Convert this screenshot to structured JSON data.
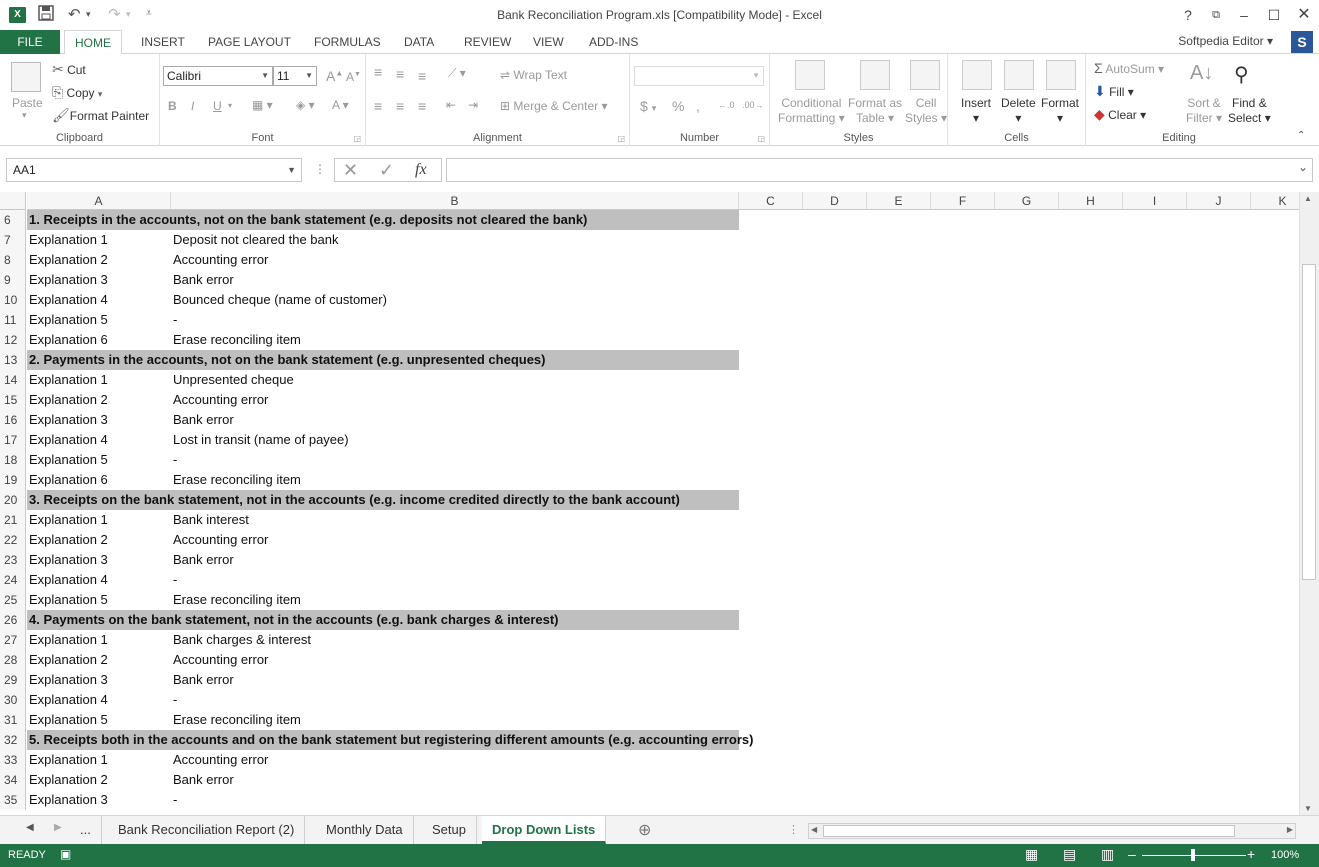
{
  "window": {
    "title": "Bank Reconciliation Program.xls  [Compatibility Mode] - Excel",
    "help": "?",
    "user": "Softpedia Editor",
    "user_initial": "S"
  },
  "tabs": [
    {
      "label": "FILE"
    },
    {
      "label": "HOME"
    },
    {
      "label": "INSERT"
    },
    {
      "label": "PAGE LAYOUT"
    },
    {
      "label": "FORMULAS"
    },
    {
      "label": "DATA"
    },
    {
      "label": "REVIEW"
    },
    {
      "label": "VIEW"
    },
    {
      "label": "ADD-INS"
    }
  ],
  "ribbon": {
    "clipboard": {
      "label": "Clipboard",
      "paste": "Paste",
      "cut": "Cut",
      "copy": "Copy",
      "format_painter": "Format Painter"
    },
    "font": {
      "label": "Font",
      "name": "Calibri",
      "size": "11",
      "bold": "B",
      "italic": "I",
      "underline": "U"
    },
    "alignment": {
      "label": "Alignment",
      "wrap": "Wrap Text",
      "merge": "Merge & Center"
    },
    "number": {
      "label": "Number",
      "currency": "$",
      "percent": "%",
      "comma": ","
    },
    "styles": {
      "label": "Styles",
      "cond1": "Conditional",
      "cond2": "Formatting",
      "table1": "Format as",
      "table2": "Table",
      "cell1": "Cell",
      "cell2": "Styles"
    },
    "cells": {
      "label": "Cells",
      "insert": "Insert",
      "delete": "Delete",
      "format": "Format"
    },
    "editing": {
      "label": "Editing",
      "autosum": "AutoSum",
      "fill": "Fill",
      "clear": "Clear",
      "sort1": "Sort &",
      "sort2": "Filter",
      "find1": "Find &",
      "find2": "Select"
    }
  },
  "formula_bar": {
    "name_box": "AA1",
    "fx": "fx",
    "value": ""
  },
  "columns": [
    "A",
    "B",
    "C",
    "D",
    "E",
    "F",
    "G",
    "H",
    "I",
    "J",
    "K"
  ],
  "rows": [
    {
      "n": "6",
      "header": true,
      "a": "1. Receipts in the accounts, not on the bank statement (e.g. deposits not cleared the bank)"
    },
    {
      "n": "7",
      "a": "Explanation 1",
      "b": "Deposit not cleared the bank"
    },
    {
      "n": "8",
      "a": "Explanation 2",
      "b": "Accounting error"
    },
    {
      "n": "9",
      "a": "Explanation 3",
      "b": "Bank error"
    },
    {
      "n": "10",
      "a": "Explanation 4",
      "b": "Bounced cheque (name of customer)"
    },
    {
      "n": "11",
      "a": "Explanation 5",
      "b": "-"
    },
    {
      "n": "12",
      "a": "Explanation 6",
      "b": "Erase reconciling item"
    },
    {
      "n": "13",
      "header": true,
      "a": "2. Payments in the accounts, not on the bank statement (e.g. unpresented cheques)"
    },
    {
      "n": "14",
      "a": "Explanation 1",
      "b": "Unpresented cheque"
    },
    {
      "n": "15",
      "a": "Explanation 2",
      "b": "Accounting error"
    },
    {
      "n": "16",
      "a": "Explanation 3",
      "b": "Bank error"
    },
    {
      "n": "17",
      "a": "Explanation 4",
      "b": "Lost in transit (name of payee)"
    },
    {
      "n": "18",
      "a": "Explanation 5",
      "b": "-"
    },
    {
      "n": "19",
      "a": "Explanation 6",
      "b": "Erase reconciling item"
    },
    {
      "n": "20",
      "header": true,
      "a": "3. Receipts on the bank statement, not in the accounts (e.g. income credited directly to the bank account)"
    },
    {
      "n": "21",
      "a": "Explanation 1",
      "b": "Bank interest"
    },
    {
      "n": "22",
      "a": "Explanation 2",
      "b": "Accounting error"
    },
    {
      "n": "23",
      "a": "Explanation 3",
      "b": "Bank error"
    },
    {
      "n": "24",
      "a": "Explanation 4",
      "b": "-"
    },
    {
      "n": "25",
      "a": "Explanation 5",
      "b": "Erase reconciling item"
    },
    {
      "n": "26",
      "header": true,
      "a": "4. Payments on the bank statement, not in the accounts (e.g. bank charges & interest)"
    },
    {
      "n": "27",
      "a": "Explanation 1",
      "b": "Bank charges & interest"
    },
    {
      "n": "28",
      "a": "Explanation 2",
      "b": "Accounting error"
    },
    {
      "n": "29",
      "a": "Explanation 3",
      "b": "Bank error"
    },
    {
      "n": "30",
      "a": "Explanation 4",
      "b": "-"
    },
    {
      "n": "31",
      "a": "Explanation 5",
      "b": "Erase reconciling item"
    },
    {
      "n": "32",
      "header": true,
      "a": "5. Receipts both in the accounts and on the bank statement but registering different amounts (e.g. accounting errors)"
    },
    {
      "n": "33",
      "a": "Explanation 1",
      "b": "Accounting error"
    },
    {
      "n": "34",
      "a": "Explanation 2",
      "b": "Bank error"
    },
    {
      "n": "35",
      "a": "Explanation 3",
      "b": "-"
    }
  ],
  "sheets": {
    "more": "...",
    "tabs": [
      "Bank Reconciliation Report (2)",
      "Monthly Data",
      "Setup",
      "Drop Down Lists"
    ],
    "active": "Drop Down Lists"
  },
  "status": {
    "mode": "READY",
    "zoom": "100%"
  },
  "colors": {
    "excel_green": "#217346",
    "header_band": "#bfbfbf"
  }
}
